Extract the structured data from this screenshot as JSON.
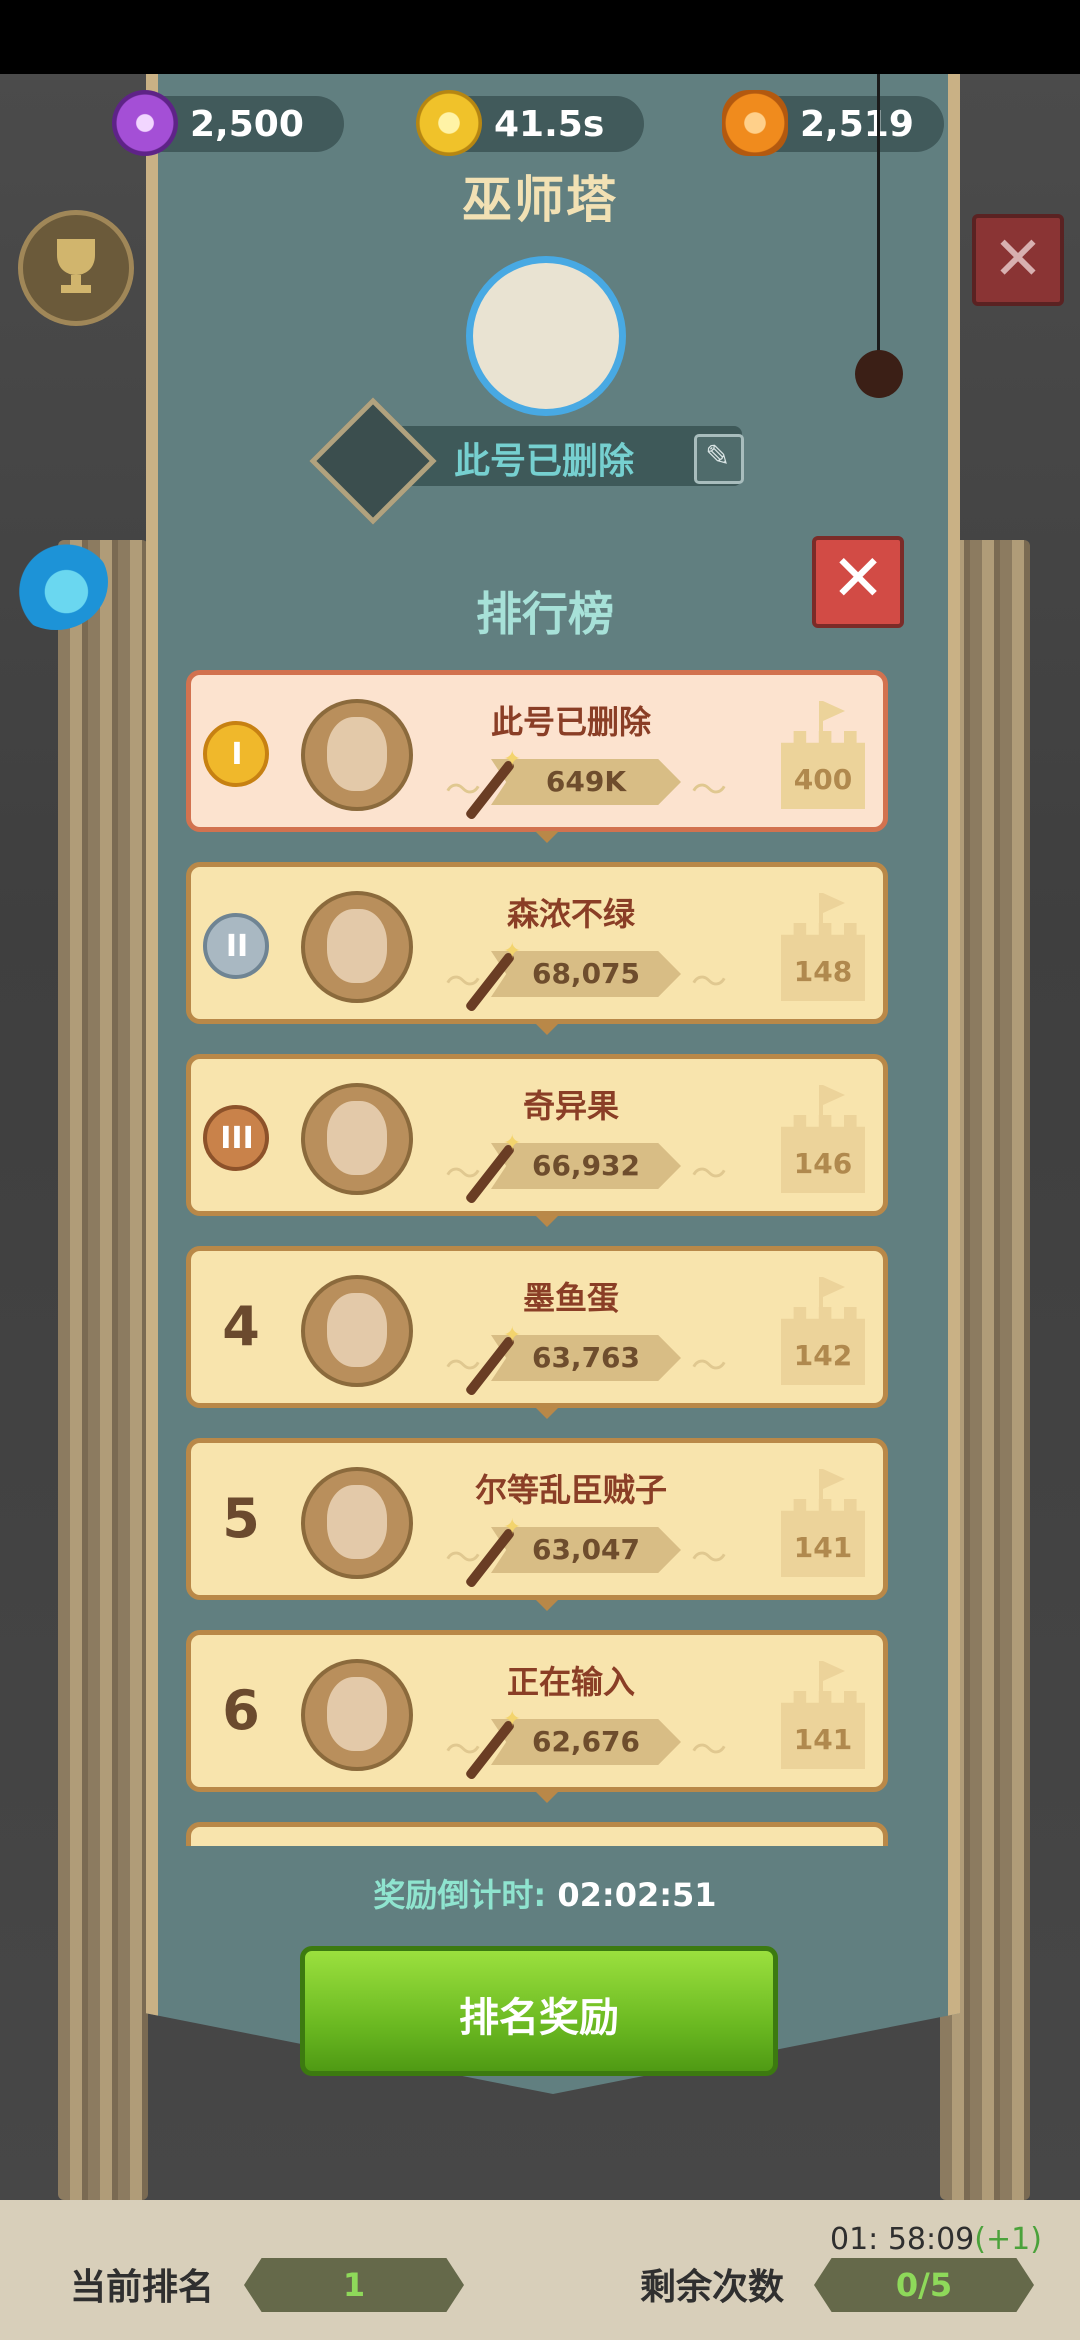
{
  "currencies": [
    {
      "icon": "purple-gem-icon",
      "value": "2,500"
    },
    {
      "icon": "gold-coin-icon",
      "value": "41.5s"
    },
    {
      "icon": "orange-stone-icon",
      "value": "2,519"
    }
  ],
  "tower": {
    "title": "巫师塔",
    "player_name": "此号已删除"
  },
  "leaderboard": {
    "title": "排行榜",
    "rows": [
      {
        "rank": "I",
        "medal": "gold",
        "name": "此号已删除",
        "score": "649K",
        "floor": "400"
      },
      {
        "rank": "II",
        "medal": "silver",
        "name": "森浓不绿",
        "score": "68,075",
        "floor": "148"
      },
      {
        "rank": "III",
        "medal": "bronze",
        "name": "奇异果",
        "score": "66,932",
        "floor": "146"
      },
      {
        "rank": "4",
        "medal": "",
        "name": "墨鱼蛋",
        "score": "63,763",
        "floor": "142"
      },
      {
        "rank": "5",
        "medal": "",
        "name": "尔等乱臣贼子",
        "score": "63,047",
        "floor": "141"
      },
      {
        "rank": "6",
        "medal": "",
        "name": "正在输入",
        "score": "62,676",
        "floor": "141"
      }
    ]
  },
  "countdown": {
    "label": "奖励倒计时:",
    "time": "02:02:51"
  },
  "reward_button": "排名奖励",
  "bottom": {
    "current_rank_label": "当前排名",
    "current_rank_value": "1",
    "remaining_label": "剩余次数",
    "remaining_value": "0/5",
    "timer": "01: 58:09",
    "timer_bonus": "(+1)"
  },
  "colors": {
    "accent_green": "#6cba22",
    "panel": "#617f80",
    "row": "#f8e4ad"
  }
}
